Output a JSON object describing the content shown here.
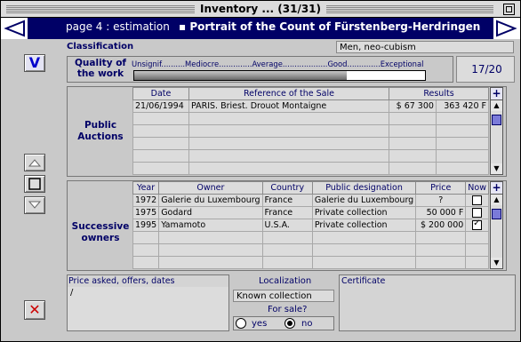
{
  "window": {
    "title": "Inventory ... (31/31)"
  },
  "header": {
    "page_label": "page 4 : estimation",
    "record_title": "Portrait of the Count of Fürstenberg-Herdringen"
  },
  "classification": {
    "label": "Classification",
    "value": "Men, neo-cubism"
  },
  "quality": {
    "label_line1": "Quality of",
    "label_line2": "the work",
    "scale": "Unsignif..........Mediocre..............Average...................Good..............Exceptional",
    "level": 0.73,
    "score": "17",
    "score_max": "/20"
  },
  "side_buttons": {
    "v_label": "V",
    "cancel_glyph": "✕"
  },
  "auctions": {
    "label_line1": "Public",
    "label_line2": "Auctions",
    "columns": [
      "Date",
      "Reference of the Sale",
      "Results"
    ],
    "rows": [
      {
        "date": "21/06/1994",
        "ref": "PARIS. Briest. Drouot Montaigne",
        "result_usd": "$ 67 300",
        "result_frf": "363 420 F"
      }
    ]
  },
  "owners": {
    "label_line1": "Successive",
    "label_line2": "owners",
    "columns": [
      "Year",
      "Owner",
      "Country",
      "Public designation",
      "Price",
      "Now"
    ],
    "rows": [
      {
        "year": "1972",
        "owner": "Galerie du Luxembourg",
        "country": "France",
        "designation": "Galerie du Luxembourg",
        "price": "?",
        "now": false
      },
      {
        "year": "1975",
        "owner": "Godard",
        "country": "France",
        "designation": "Private collection",
        "price": "50 000 F",
        "now": false
      },
      {
        "year": "1995",
        "owner": "Yamamoto",
        "country": "U.S.A.",
        "designation": "Private collection",
        "price": "$ 200 000",
        "now": true
      }
    ]
  },
  "price_asked": {
    "label": "Price asked, offers, dates",
    "value": "/"
  },
  "localization": {
    "label": "Localization",
    "value": "Known collection",
    "for_sale_label": "For sale?",
    "yes_label": "yes",
    "no_label": "no",
    "for_sale": "no"
  },
  "certificate": {
    "label": "Certificate"
  },
  "colors": {
    "navy": "#000066",
    "panel": "#c9c9c9",
    "field": "#dcdcdc",
    "cancel_red": "#cc0000"
  }
}
